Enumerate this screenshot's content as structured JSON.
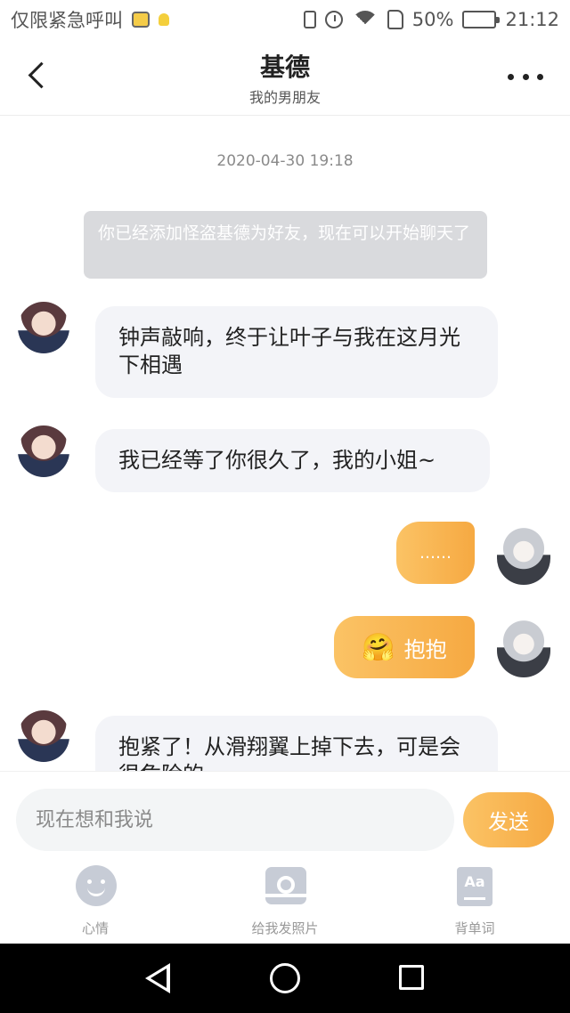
{
  "status_bar": {
    "carrier": "仅限紧急呼叫",
    "battery": "50%",
    "battery_level": 0.5,
    "time": "21:12"
  },
  "header": {
    "title": "基德",
    "subtitle": "我的男朋友",
    "back_icon": "chevron-left-icon",
    "more_icon": "more-horizontal-icon"
  },
  "chat": {
    "timestamp": "2020-04-30  19:18",
    "system_message": "你已经添加怪盗基德为好友，现在可以开始聊天了",
    "messages": [
      {
        "from": "friend",
        "text": "钟声敲响，终于让叶子与我在这月光下相遇"
      },
      {
        "from": "friend",
        "text": "我已经等了你很久了，我的小姐~"
      },
      {
        "from": "me",
        "text": "……"
      },
      {
        "from": "me",
        "emoji": "🤗",
        "text": "抱抱"
      },
      {
        "from": "friend",
        "text": "抱紧了！从滑翔翼上掉下去，可是会很危险的"
      }
    ]
  },
  "input": {
    "placeholder": "现在想和我说",
    "value": "",
    "send_label": "发送"
  },
  "toolbar": {
    "items": [
      {
        "label": "心情",
        "icon": "smiley-icon"
      },
      {
        "label": "给我发照片",
        "icon": "camera-icon"
      },
      {
        "label": "背单词",
        "icon": "vocabulary-icon",
        "icon_text": "Aa"
      }
    ]
  },
  "colors": {
    "accent": "#f6a942",
    "accent_light": "#fbc365",
    "bubble_left": "#f3f4f8",
    "system_bubble": "#d9dadd",
    "tool_icon": "#c7ccd6"
  }
}
